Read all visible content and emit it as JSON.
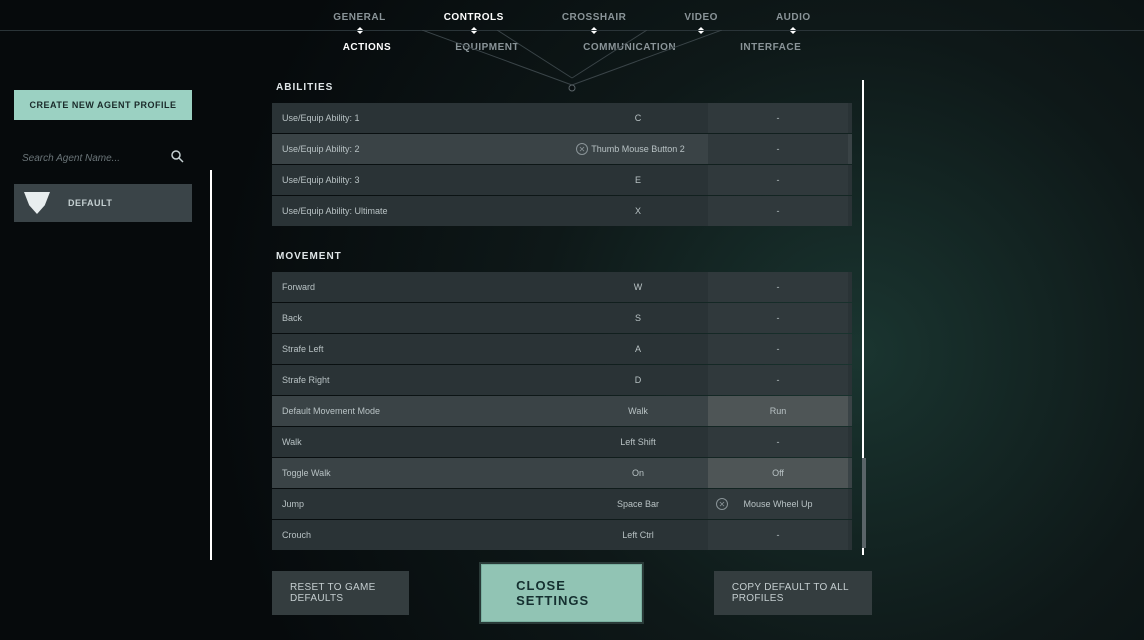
{
  "tabs": [
    "GENERAL",
    "CONTROLS",
    "CROSSHAIR",
    "VIDEO",
    "AUDIO"
  ],
  "activeTab": 1,
  "subTabs": [
    "ACTIONS",
    "EQUIPMENT",
    "COMMUNICATION",
    "INTERFACE"
  ],
  "activeSubTab": 0,
  "sidebar": {
    "createLabel": "CREATE NEW AGENT PROFILE",
    "searchPlaceholder": "Search Agent Name...",
    "profile": "DEFAULT"
  },
  "sections": [
    {
      "title": "ABILITIES",
      "rows": [
        {
          "label": "Use/Equip Ability: 1",
          "bind1": "C",
          "bind2": "-",
          "hl": false,
          "clear1": false,
          "clear2": false,
          "alt2": false
        },
        {
          "label": "Use/Equip Ability: 2",
          "bind1": "Thumb Mouse Button 2",
          "bind2": "-",
          "hl": true,
          "clear1": true,
          "clear2": false,
          "alt2": false
        },
        {
          "label": "Use/Equip Ability: 3",
          "bind1": "E",
          "bind2": "-",
          "hl": false,
          "clear1": false,
          "clear2": false,
          "alt2": false
        },
        {
          "label": "Use/Equip Ability: Ultimate",
          "bind1": "X",
          "bind2": "-",
          "hl": false,
          "clear1": false,
          "clear2": false,
          "alt2": false
        }
      ]
    },
    {
      "title": "MOVEMENT",
      "rows": [
        {
          "label": "Forward",
          "bind1": "W",
          "bind2": "-",
          "hl": false,
          "clear1": false,
          "clear2": false,
          "alt2": false
        },
        {
          "label": "Back",
          "bind1": "S",
          "bind2": "-",
          "hl": false,
          "clear1": false,
          "clear2": false,
          "alt2": false
        },
        {
          "label": "Strafe Left",
          "bind1": "A",
          "bind2": "-",
          "hl": false,
          "clear1": false,
          "clear2": false,
          "alt2": false
        },
        {
          "label": "Strafe Right",
          "bind1": "D",
          "bind2": "-",
          "hl": false,
          "clear1": false,
          "clear2": false,
          "alt2": false
        },
        {
          "label": "Default Movement Mode",
          "bind1": "Walk",
          "bind2": "Run",
          "hl": true,
          "clear1": false,
          "clear2": false,
          "alt2": true
        },
        {
          "label": "Walk",
          "bind1": "Left Shift",
          "bind2": "-",
          "hl": false,
          "clear1": false,
          "clear2": false,
          "alt2": false
        },
        {
          "label": "Toggle Walk",
          "bind1": "On",
          "bind2": "Off",
          "hl": true,
          "clear1": false,
          "clear2": false,
          "alt2": true
        },
        {
          "label": "Jump",
          "bind1": "Space Bar",
          "bind2": "Mouse Wheel Up",
          "hl": false,
          "clear1": false,
          "clear2": true,
          "alt2": false
        },
        {
          "label": "Crouch",
          "bind1": "Left Ctrl",
          "bind2": "-",
          "hl": false,
          "clear1": false,
          "clear2": false,
          "alt2": false
        }
      ]
    }
  ],
  "footer": {
    "reset": "RESET TO GAME DEFAULTS",
    "close": "CLOSE SETTINGS",
    "copy": "COPY DEFAULT TO ALL PROFILES"
  }
}
